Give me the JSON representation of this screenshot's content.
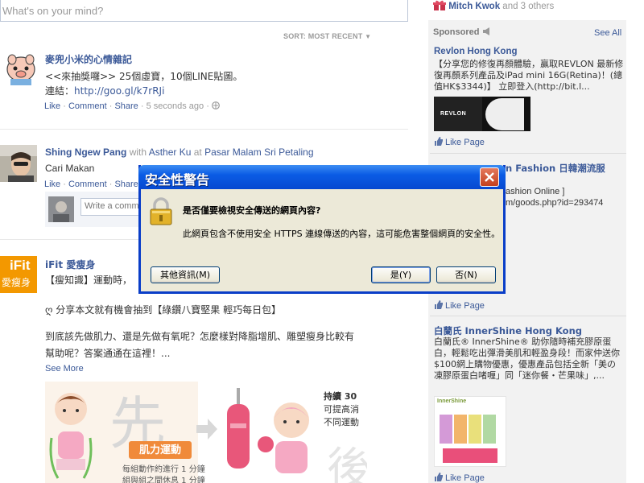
{
  "composer": {
    "placeholder": "What's on your mind?"
  },
  "feed": {
    "sort_label": "SORT: MOST RECENT",
    "posts": [
      {
        "author": "麥兜小米的心情雜記",
        "lines": [
          "<<來抽獎囉>> 25個虛寶，10個LINE貼圖。"
        ],
        "link_prefix": "連結：",
        "link": "http://goo.gl/k7rRJi",
        "actions": {
          "like": "Like",
          "comment": "Comment",
          "share": "Share",
          "time": "5 seconds ago"
        }
      },
      {
        "author": "Shing Ngew Pang",
        "with_text": "with",
        "with_name": "Asther Ku",
        "at_text": "at",
        "place": "Pasar Malam Sri Petaling",
        "text": "Cari Makan",
        "actions": {
          "like": "Like",
          "comment": "Comment",
          "share": "Share"
        },
        "comment_placeholder": "Write a comme"
      },
      {
        "author": "iFit 愛瘦身",
        "logo_text": "iFit",
        "logo_sub": "愛瘦身",
        "line1": "【瘦知識】運動時，",
        "line2": "ღ 分享本文就有機會抽到【綠鑽八寶堅果 輕巧每日包】",
        "line3": "到底該先做肌力、還是先做有氧呢？怎麼樣對降脂增肌、雕塑瘦身比較有",
        "line4": "幫助呢？答案通通在這裡！...",
        "see_more": "See More",
        "image_text": {
          "big_char_1": "先",
          "big_char_2": "後",
          "label": "肌力運動",
          "caption1": "每組動作約進行 1 分鐘",
          "caption2": "組與組之間休息 1 分鐘",
          "side1": "持續 30",
          "side2": "可提高消",
          "side3": "不同運動"
        }
      }
    ]
  },
  "sidebar": {
    "friends_line_name": "Mitch Kwok",
    "friends_line_rest": "and 3 others",
    "sponsored": "Sponsored",
    "see_all": "See All",
    "ads": [
      {
        "title": "Revlon Hong Kong",
        "body": "【分享您的修復再顏體驗，贏取REVLON 最新修復再顏系列產品及iPad mini 16G(Retina)！(總值HK$3344)】 立即登入(http://bit.l...",
        "like": "Like Page",
        "image_brand": "REVLON"
      },
      {
        "title_partial": "n Fashion 日韓潮流服",
        "body_partial_1": "ashion Online ]",
        "body_partial_2": "m/goods.php?id=293474",
        "like": "Like Page"
      },
      {
        "title": "白蘭氏 InnerShine Hong Kong",
        "body": "白蘭氏® InnerShine® 助你隨時補充膠原蛋白，輕鬆吃出彈滑美肌和輕盈身段！而家仲送你$100網上購物優惠，優惠產品包括全新「美の凍膠原蛋白啫喱」同「迷你餐・芒果味」,...",
        "like": "Like Page",
        "image_brand": "InnerShine"
      }
    ]
  },
  "dialog": {
    "title": "安全性警告",
    "question": "是否僅要檢視安全傳送的網頁內容?",
    "detail": "此網頁包含不使用安全 HTTPS 連線傳送的內容，這可能危害整個網頁的安全性。",
    "more_info": "其他資訊(M)",
    "yes": "是(Y)",
    "no": "否(N)"
  },
  "colors": {
    "fb_blue": "#3b5998",
    "dialog_blue": "#0a3ec8",
    "dialog_face": "#ece9d8"
  }
}
